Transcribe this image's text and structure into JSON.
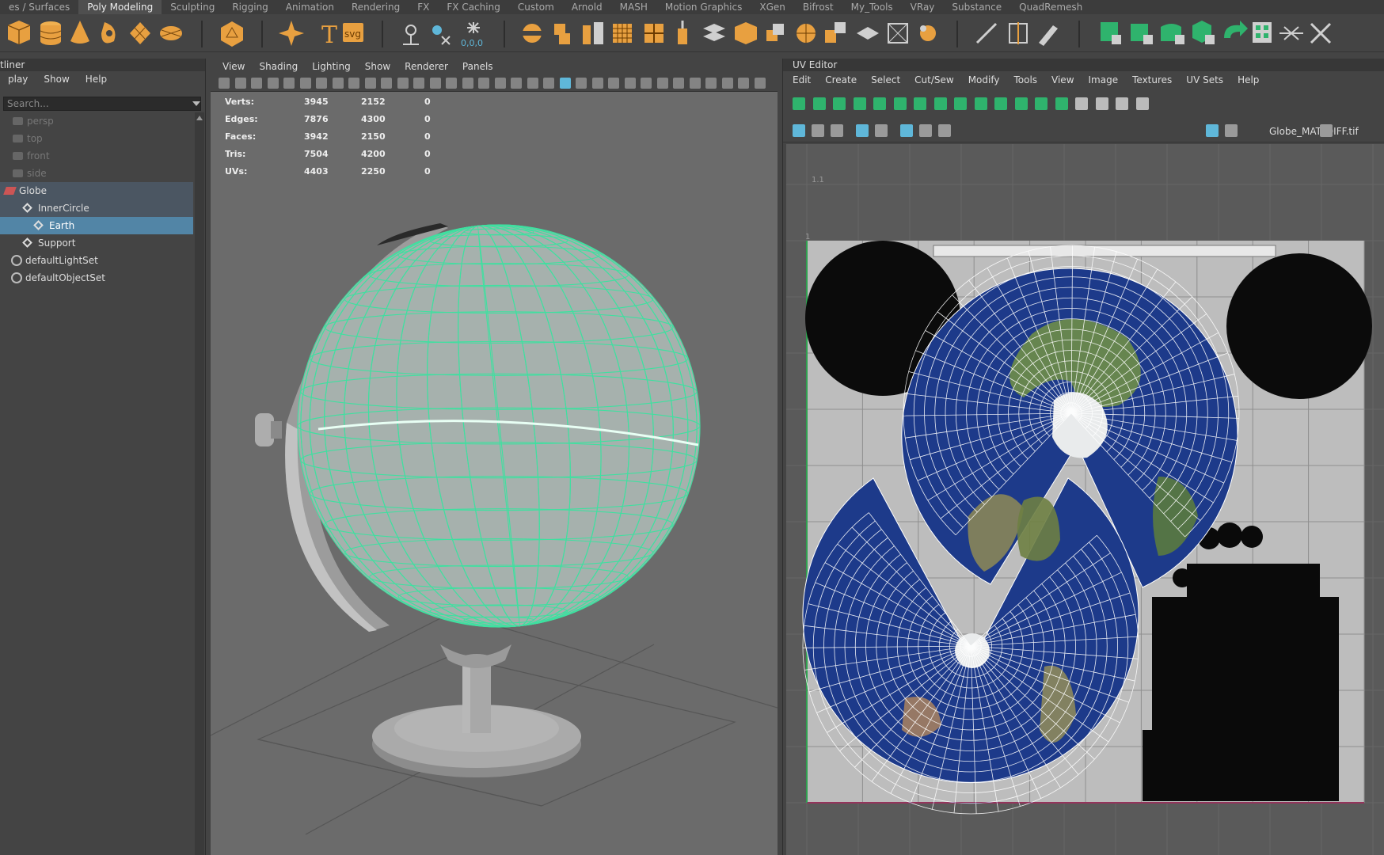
{
  "shelf": {
    "tabs": [
      "es / Surfaces",
      "Poly Modeling",
      "Sculpting",
      "Rigging",
      "Animation",
      "Rendering",
      "FX",
      "FX Caching",
      "Custom",
      "Arnold",
      "MASH",
      "Motion Graphics",
      "XGen",
      "Bifrost",
      "My_Tools",
      "VRay",
      "Substance",
      "QuadRemesh"
    ],
    "active_tab": "Poly Modeling",
    "svg_label": "svg",
    "coord_label": "0,0,0",
    "accent_orange": "#e8a040",
    "accent_green": "#2fb36d"
  },
  "outliner": {
    "title": "tliner",
    "menu": [
      "play",
      "Show",
      "Help"
    ],
    "search_placeholder": "Search...",
    "items": [
      {
        "label": "persp",
        "icon": "camera-icon"
      },
      {
        "label": "top",
        "icon": "camera-icon"
      },
      {
        "label": "front",
        "icon": "camera-icon"
      },
      {
        "label": "side",
        "icon": "camera-icon"
      },
      {
        "label": "Globe",
        "icon": "transform-icon"
      },
      {
        "label": "InnerCircle",
        "icon": "group-icon"
      },
      {
        "label": "Earth",
        "icon": "mesh-icon"
      },
      {
        "label": "Support",
        "icon": "group-icon"
      },
      {
        "label": "defaultLightSet",
        "icon": "set-icon"
      },
      {
        "label": "defaultObjectSet",
        "icon": "set-icon"
      }
    ],
    "selected": "Earth"
  },
  "viewport": {
    "menu": [
      "View",
      "Shading",
      "Lighting",
      "Show",
      "Renderer",
      "Panels"
    ],
    "hud": [
      {
        "label": "Verts:",
        "v1": "3945",
        "v2": "2152",
        "v3": "0"
      },
      {
        "label": "Edges:",
        "v1": "7876",
        "v2": "4300",
        "v3": "0"
      },
      {
        "label": "Faces:",
        "v1": "3942",
        "v2": "2150",
        "v3": "0"
      },
      {
        "label": "Tris:",
        "v1": "7504",
        "v2": "4200",
        "v3": "0"
      },
      {
        "label": "UVs:",
        "v1": "4403",
        "v2": "2250",
        "v3": "0"
      }
    ],
    "wire_color": "#3fe0a0"
  },
  "uv_editor": {
    "title": "UV Editor",
    "menu": [
      "Edit",
      "Create",
      "Select",
      "Cut/Sew",
      "Modify",
      "Tools",
      "View",
      "Image",
      "Textures",
      "UV Sets",
      "Help"
    ],
    "texture_name": "Globe_MAT_DIFF.tif",
    "grid_label_top": "1.1",
    "grid_label_one": "1"
  }
}
